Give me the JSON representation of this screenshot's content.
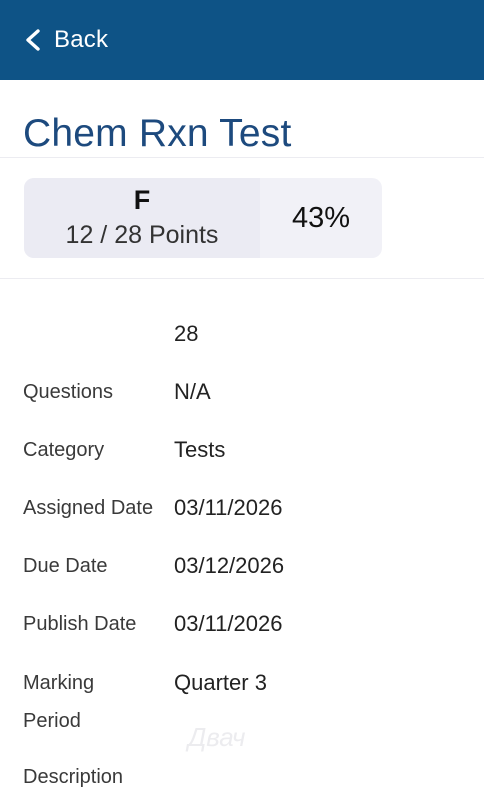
{
  "header": {
    "back_label": "Back",
    "bg_color": "#0e5386"
  },
  "assignment": {
    "title": "Chem Rxn Test"
  },
  "score": {
    "grade": "F",
    "points": "12 / 28 Points",
    "percent": "43%"
  },
  "details": [
    {
      "label": "",
      "value": "28"
    },
    {
      "label": "Questions",
      "value": "N/A"
    },
    {
      "label": "Category",
      "value": "Tests"
    },
    {
      "label": "Assigned Date",
      "value": "03/11/2026"
    },
    {
      "label": "Due Date",
      "value": "03/12/2026"
    },
    {
      "label": "Publish Date",
      "value": "03/11/2026"
    },
    {
      "label": "Marking Period",
      "value": "Quarter 3"
    },
    {
      "label": "Description",
      "value": ""
    }
  ],
  "watermark": {
    "text": "Двач"
  }
}
